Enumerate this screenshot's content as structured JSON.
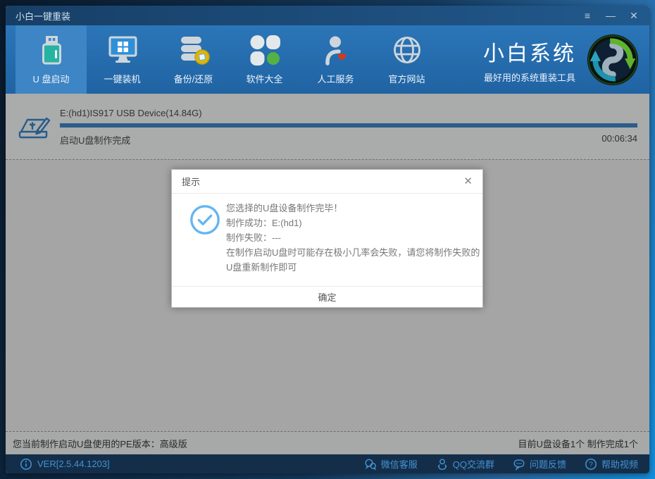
{
  "titlebar": {
    "title": "小白一键重装",
    "menu_glyph": "≡",
    "minimize_glyph": "—",
    "close_glyph": "✕"
  },
  "nav": {
    "tabs": [
      {
        "label": "U 盘启动",
        "icon": "usb-drive-icon",
        "active": true
      },
      {
        "label": "一键装机",
        "icon": "monitor-windows-icon",
        "active": false
      },
      {
        "label": "备份/还原",
        "icon": "database-coin-icon",
        "active": false
      },
      {
        "label": "软件大全",
        "icon": "clover-apps-icon",
        "active": false
      },
      {
        "label": "人工服务",
        "icon": "person-heart-icon",
        "active": false
      },
      {
        "label": "官方网站",
        "icon": "globe-icon",
        "active": false
      }
    ],
    "brand": {
      "name": "小白系统",
      "tagline": "最好用的系统重装工具",
      "emblem": "refresh-arrows-logo"
    }
  },
  "progress": {
    "device": "E:(hd1)IS917 USB Device(14.84G)",
    "status": "启动U盘制作完成",
    "elapsed": "00:06:34",
    "percent": 100
  },
  "dialog": {
    "title": "提示",
    "close_glyph": "✕",
    "icon": "check-circle-icon",
    "lines": [
      "您选择的U盘设备制作完毕！",
      "制作成功：E:(hd1)",
      "制作失败：---",
      "在制作启动U盘时可能存在极小几率会失败，请您将制作失败的U盘重新制作即可"
    ],
    "confirm_label": "确定"
  },
  "status_bar": {
    "left": "您当前制作启动U盘使用的PE版本：高级版",
    "right": "目前U盘设备1个 制作完成1个"
  },
  "footer": {
    "version": "VER[2.5.44.1203]",
    "links": [
      {
        "label": "微信客服",
        "icon": "wechat-icon"
      },
      {
        "label": "QQ交流群",
        "icon": "qq-icon"
      },
      {
        "label": "问题反馈",
        "icon": "feedback-bubble-icon"
      },
      {
        "label": "帮助视频",
        "icon": "help-circle-icon"
      }
    ]
  },
  "colors": {
    "nav_blue": "#2b76b8",
    "active_tab": "#3d85c4",
    "progress_bar": "#3e86c5",
    "usb_teal": "#27b3a2",
    "clover_green": "#55b145",
    "heart_red": "#cf3a22",
    "coin_yellow": "#d9b70d",
    "footer_link": "#4493d2",
    "check_blue": "#64b5f0"
  }
}
